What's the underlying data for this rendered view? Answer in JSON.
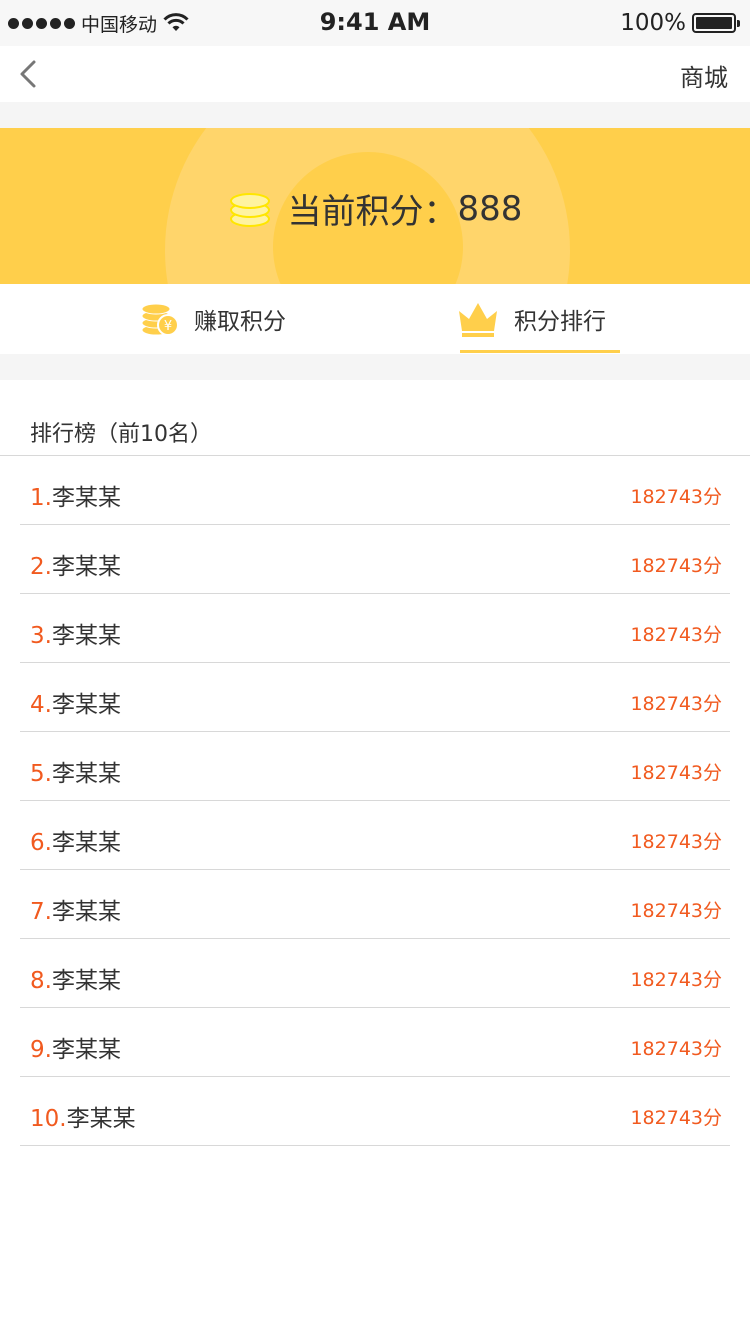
{
  "status_bar": {
    "carrier": "中国移动",
    "time": "9:41 AM",
    "battery": "100%"
  },
  "nav": {
    "right_label": "商城"
  },
  "banner": {
    "label": "当前积分：",
    "value": "888"
  },
  "tabs": [
    {
      "label": "赚取积分",
      "icon": "coin-yen-icon"
    },
    {
      "label": "积分排行",
      "icon": "crown-icon",
      "active": true
    }
  ],
  "leaderboard": {
    "title": "排行榜（前10名）",
    "rows": [
      {
        "rank": "1.",
        "name": "李某某",
        "score": "182743分"
      },
      {
        "rank": "2.",
        "name": "李某某",
        "score": "182743分"
      },
      {
        "rank": "3.",
        "name": "李某某",
        "score": "182743分"
      },
      {
        "rank": "4.",
        "name": "李某某",
        "score": "182743分"
      },
      {
        "rank": "5.",
        "name": "李某某",
        "score": "182743分"
      },
      {
        "rank": "6.",
        "name": "李某某",
        "score": "182743分"
      },
      {
        "rank": "7.",
        "name": "李某某",
        "score": "182743分"
      },
      {
        "rank": "8.",
        "name": "李某某",
        "score": "182743分"
      },
      {
        "rank": "9.",
        "name": "李某某",
        "score": "182743分"
      },
      {
        "rank": "10.",
        "name": "李某某",
        "score": "182743分"
      }
    ]
  },
  "colors": {
    "accent_yellow": "#ffcf4b",
    "rank_orange": "#f15a1f"
  }
}
